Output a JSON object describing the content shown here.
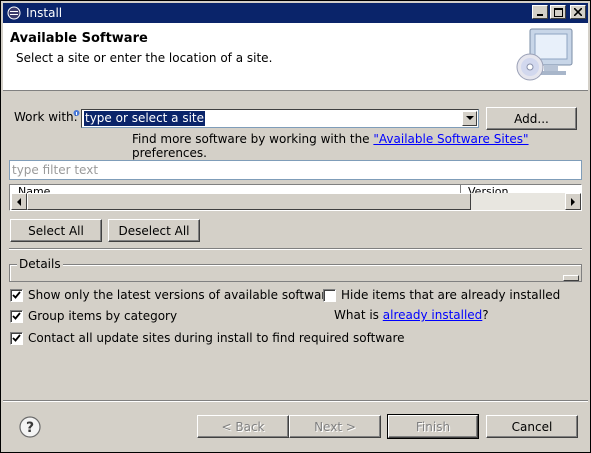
{
  "window": {
    "title": "Install"
  },
  "banner": {
    "title": "Available Software",
    "description": "Select a site or enter the location of a site."
  },
  "work_with": {
    "label": "Work with:",
    "value": "type or select a site",
    "add_button": "Add..."
  },
  "more_sites": {
    "prefix": "Find more software by working with the ",
    "link": "\"Available Software Sites\"",
    "suffix": " preferences."
  },
  "filter": {
    "placeholder": "type filter text"
  },
  "table": {
    "columns": [
      "Name",
      "Version"
    ]
  },
  "buttons": {
    "select_all": "Select All",
    "deselect_all": "Deselect All"
  },
  "details": {
    "legend": "Details"
  },
  "options": {
    "show_latest": {
      "label": "Show only the latest versions of available software",
      "checked": true
    },
    "hide_installed": {
      "label": "Hide items that are already installed",
      "checked": false
    },
    "group_by_category": {
      "label": "Group items by category",
      "checked": true
    },
    "what_is_prefix": "What is ",
    "already_installed_link": "already installed",
    "what_is_suffix": "?",
    "contact_all_sites": {
      "label": "Contact all update sites during install to find required software",
      "checked": true
    }
  },
  "footer": {
    "back": "< Back",
    "next": "Next >",
    "finish": "Finish",
    "cancel": "Cancel"
  },
  "icons": {
    "app": "eclipse-icon",
    "help": "help-icon",
    "banner": "computer-cd-icon"
  }
}
